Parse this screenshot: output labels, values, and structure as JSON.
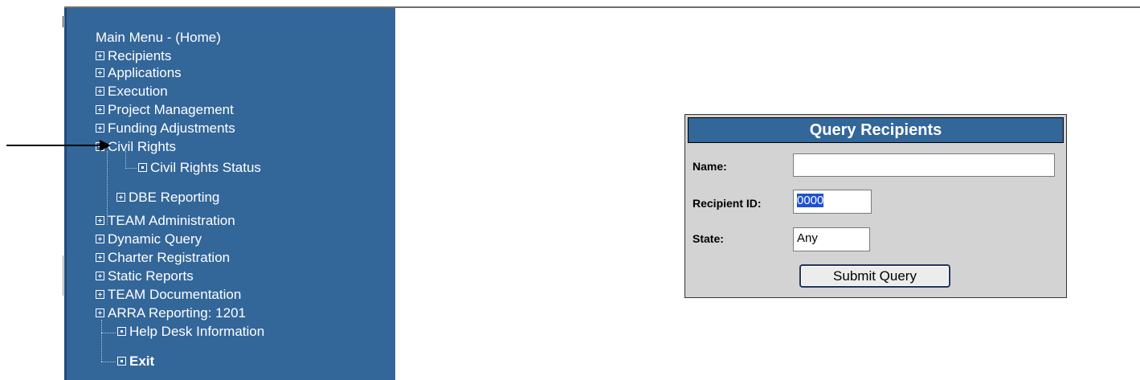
{
  "sidebar": {
    "home": "Main Menu - (Home)",
    "items": [
      {
        "label": "Recipients",
        "icon": "plus-box-icon"
      },
      {
        "label": "Applications",
        "icon": "plus-box-icon"
      },
      {
        "label": "Execution",
        "icon": "plus-box-icon"
      },
      {
        "label": "Project Management",
        "icon": "plus-box-icon"
      },
      {
        "label": "Funding Adjustments",
        "icon": "plus-box-icon"
      },
      {
        "label": "Civil Rights",
        "icon": "minus-box-icon"
      },
      {
        "label": "Civil Rights Status",
        "icon": "dot-box-icon"
      },
      {
        "label": "DBE Reporting",
        "icon": "plus-box-icon"
      },
      {
        "label": "TEAM Administration",
        "icon": "plus-box-icon"
      },
      {
        "label": "Dynamic Query",
        "icon": "plus-box-icon"
      },
      {
        "label": "Charter Registration",
        "icon": "plus-box-icon"
      },
      {
        "label": "Static Reports",
        "icon": "plus-box-icon"
      },
      {
        "label": "TEAM Documentation",
        "icon": "plus-box-icon"
      },
      {
        "label": "ARRA Reporting: 1201",
        "icon": "plus-box-icon"
      },
      {
        "label": "Help Desk Information",
        "icon": "dot-box-icon"
      },
      {
        "label": "Exit",
        "icon": "dot-box-icon"
      }
    ]
  },
  "query": {
    "title": "Query Recipients",
    "name_label": "Name:",
    "name_value": "",
    "recipient_id_label": "Recipient ID:",
    "recipient_id_value": "0000",
    "state_label": "State:",
    "state_value": "Any",
    "submit_label": "Submit Query"
  },
  "colors": {
    "sidebar_bg": "#336699",
    "panel_bg": "#d3d3d3",
    "title_bg": "#336699",
    "selection": "#1e50d2"
  }
}
